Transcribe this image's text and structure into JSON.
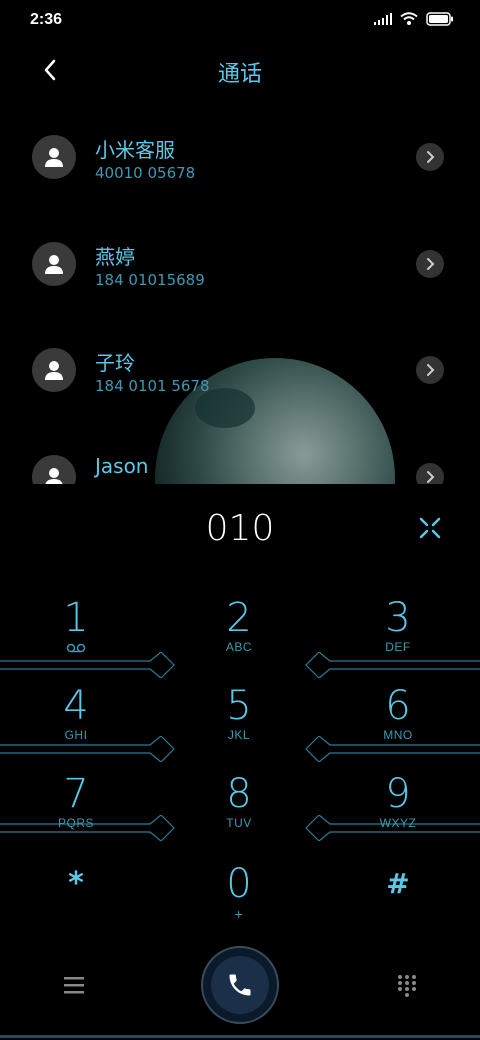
{
  "status": {
    "time": "2:36"
  },
  "header": {
    "title": "通话"
  },
  "contacts": [
    {
      "name": "小米客服",
      "number": "40010 05678"
    },
    {
      "name": "燕婷",
      "number": "184 01015689"
    },
    {
      "name": "子玲",
      "number": "184 0101 5678"
    },
    {
      "name": "Jason",
      "number": ""
    }
  ],
  "display": {
    "number": "010"
  },
  "keypad": [
    {
      "digit": "1",
      "letters": ""
    },
    {
      "digit": "2",
      "letters": "ABC"
    },
    {
      "digit": "3",
      "letters": "DEF"
    },
    {
      "digit": "4",
      "letters": "GHI"
    },
    {
      "digit": "5",
      "letters": "JKL"
    },
    {
      "digit": "6",
      "letters": "MNO"
    },
    {
      "digit": "7",
      "letters": "PQRS"
    },
    {
      "digit": "8",
      "letters": "TUV"
    },
    {
      "digit": "9",
      "letters": "WXYZ"
    },
    {
      "digit": "*",
      "letters": ""
    },
    {
      "digit": "0",
      "letters": "+"
    },
    {
      "digit": "#",
      "letters": ""
    }
  ],
  "colors": {
    "accent": "#5bc8e8",
    "background": "#000000"
  },
  "icons": [
    "back-icon",
    "clear-icon",
    "menu-icon",
    "phone-icon",
    "dialpad-icon",
    "voicemail-icon",
    "person-icon",
    "chevron-right-icon"
  ]
}
